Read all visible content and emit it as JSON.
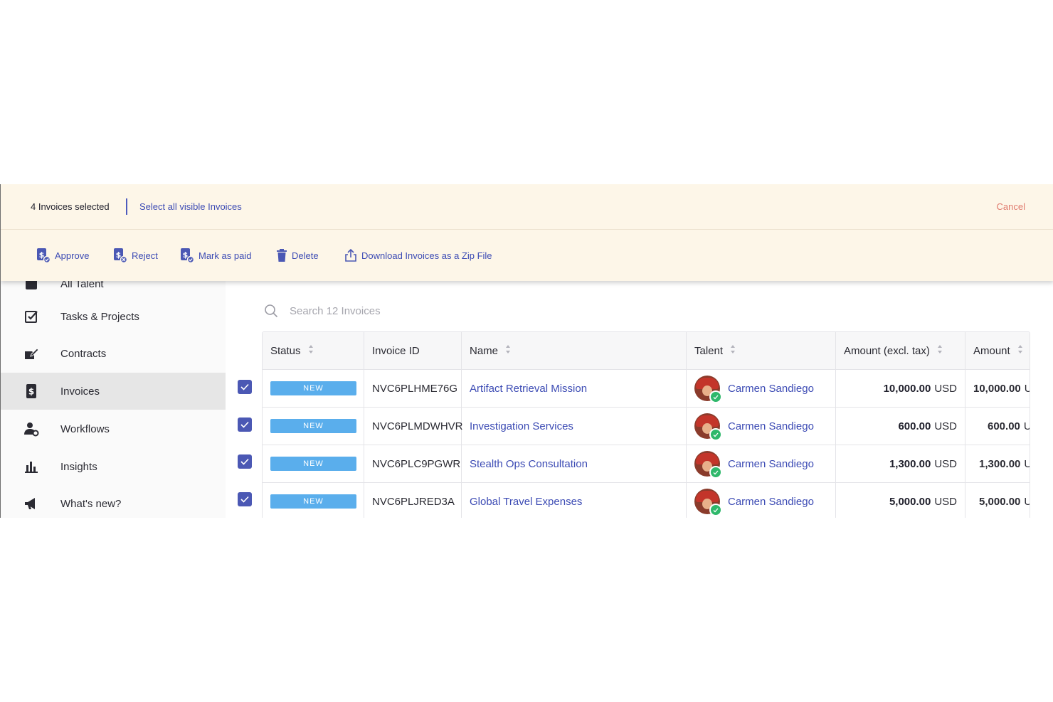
{
  "selection_bar": {
    "count_label": "4 Invoices selected",
    "select_all_label": "Select all visible Invoices",
    "cancel_label": "Cancel",
    "actions": [
      {
        "label": "Approve",
        "icon": "invoice-approve-icon"
      },
      {
        "label": "Reject",
        "icon": "invoice-reject-icon"
      },
      {
        "label": "Mark as paid",
        "icon": "invoice-paid-icon"
      },
      {
        "label": "Delete",
        "icon": "trash-icon"
      },
      {
        "label": "Download Invoices as a Zip File",
        "icon": "share-upload-icon"
      }
    ]
  },
  "sidebar": {
    "items": [
      {
        "label": "All Talent",
        "icon": "people-icon"
      },
      {
        "label": "Tasks & Projects",
        "icon": "checkbox-icon"
      },
      {
        "label": "Contracts",
        "icon": "contract-sign-icon"
      },
      {
        "label": "Invoices",
        "icon": "invoice-icon",
        "active": true
      },
      {
        "label": "Workflows",
        "icon": "workflow-user-icon"
      },
      {
        "label": "Insights",
        "icon": "bar-chart-icon"
      },
      {
        "label": "What's new?",
        "icon": "megaphone-icon"
      }
    ]
  },
  "search": {
    "placeholder": "Search 12 Invoices",
    "value": ""
  },
  "table": {
    "columns": [
      "Status",
      "Invoice ID",
      "Name",
      "Talent",
      "Amount (excl. tax)",
      "Amount"
    ],
    "rows": [
      {
        "status": "NEW",
        "invoice_id": "NVC6PLHME76G",
        "name": "Artifact Retrieval Mission",
        "talent": "Carmen Sandiego",
        "amount_excl": "10,000.00",
        "currency": "USD",
        "amount": "10,000.00",
        "amount_currency": "U"
      },
      {
        "status": "NEW",
        "invoice_id": "NVC6PLMDWHVR",
        "name": "Investigation Services",
        "talent": "Carmen Sandiego",
        "amount_excl": "600.00",
        "currency": "USD",
        "amount": "600.00",
        "amount_currency": "U"
      },
      {
        "status": "NEW",
        "invoice_id": "NVC6PLC9PGWR",
        "name": "Stealth Ops Consultation",
        "talent": "Carmen Sandiego",
        "amount_excl": "1,300.00",
        "currency": "USD",
        "amount": "1,300.00",
        "amount_currency": "U"
      },
      {
        "status": "NEW",
        "invoice_id": "NVC6PLJRED3A",
        "name": "Global Travel Expenses",
        "talent": "Carmen Sandiego",
        "amount_excl": "5,000.00",
        "currency": "USD",
        "amount": "5,000.00",
        "amount_currency": "U"
      }
    ]
  },
  "colors": {
    "accent": "#3c4bb4",
    "badge_new": "#5aaeec",
    "cancel": "#e07a6d",
    "selection_bg": "#fdf6e8"
  }
}
